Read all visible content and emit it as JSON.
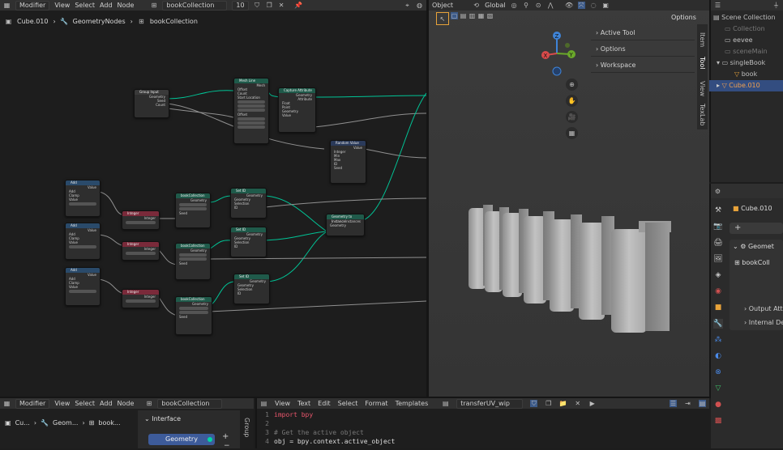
{
  "node_editor": {
    "header": {
      "editor_type": "Modifier",
      "menus": [
        "View",
        "Select",
        "Add",
        "Node"
      ],
      "tree_name": "bookCollection",
      "users": "10"
    },
    "breadcrumb": [
      "Cube.010",
      "GeometryNodes",
      "bookCollection"
    ],
    "nodes": {
      "group_input": {
        "title": "Group Input",
        "rows": [
          "Geometry",
          "Seed",
          "Count"
        ]
      },
      "mesh_line": {
        "title": "Mesh Line",
        "rows": [
          "Mesh",
          "Offset",
          "Count",
          "Start Location",
          "Offset"
        ]
      },
      "capture": {
        "title": "Capture Attribute",
        "rows": [
          "Geometry",
          "Attribute",
          "Float",
          "Point",
          "Geometry",
          "Value"
        ]
      },
      "random": {
        "title": "Random Value",
        "rows": [
          "Value",
          "Integer",
          "Min",
          "Max",
          "ID",
          "Seed"
        ]
      },
      "join": {
        "title": "Geometry to Instance",
        "rows": [
          "Instances",
          "Geometry"
        ]
      },
      "math": {
        "title": "Add",
        "rows": [
          "Value",
          "Add",
          "Clamp",
          "Value",
          "Value"
        ]
      },
      "integer": {
        "title": "Integer",
        "rows": [
          "Integer"
        ]
      },
      "collection": {
        "title": "bookCollection",
        "rows": [
          "Geometry",
          "Seed"
        ]
      },
      "set": {
        "title": "Set ID",
        "rows": [
          "Geometry",
          "Selection",
          "ID"
        ]
      }
    }
  },
  "viewport": {
    "header": {
      "mode": "Object",
      "orientation": "Global",
      "options": "Options"
    },
    "n_panel": [
      "Active Tool",
      "Options",
      "Workspace"
    ],
    "side_tabs": [
      "Item",
      "Tool",
      "View",
      "TexLab"
    ],
    "gizmo": {
      "x": "X",
      "y": "Y",
      "z": "Z"
    }
  },
  "outliner": {
    "items": [
      {
        "label": "Scene Collection",
        "dim": false
      },
      {
        "label": "Collection",
        "dim": true
      },
      {
        "label": "eevee",
        "dim": false
      },
      {
        "label": "sceneMain",
        "dim": true
      },
      {
        "label": "singleBook",
        "dim": false
      },
      {
        "label": "book",
        "dim": false
      },
      {
        "label": "Cube.010",
        "dim": false
      }
    ]
  },
  "properties": {
    "object_name": "Cube.010",
    "modifier_name": "Geomet",
    "node_group": "bookColl",
    "sections": [
      "Output Attr",
      "Internal De"
    ]
  },
  "bottom_node_editor": {
    "header": {
      "editor_type": "Modifier",
      "menus": [
        "View",
        "Select",
        "Add",
        "Node"
      ],
      "tree_name": "bookCollection"
    },
    "breadcrumb": [
      "Cu...",
      "Geom...",
      "book..."
    ],
    "interface_label": "Interface",
    "socket_label": "Geometry",
    "group_tab": "Group"
  },
  "text_editor": {
    "menus": [
      "View",
      "Text",
      "Edit",
      "Select",
      "Format",
      "Templates"
    ],
    "file_name": "transferUV_wip",
    "lines": [
      {
        "num": "1",
        "text": "import bpy"
      },
      {
        "num": "2",
        "text": ""
      },
      {
        "num": "3",
        "text": "# Get the active object"
      },
      {
        "num": "4",
        "text": "obj = bpy.context.active_object"
      }
    ]
  },
  "colors": {
    "selected": "#334d80",
    "accent_orange": "#e8a33a",
    "geometry_socket": "#00d6a3",
    "header_bg": "#303030"
  }
}
